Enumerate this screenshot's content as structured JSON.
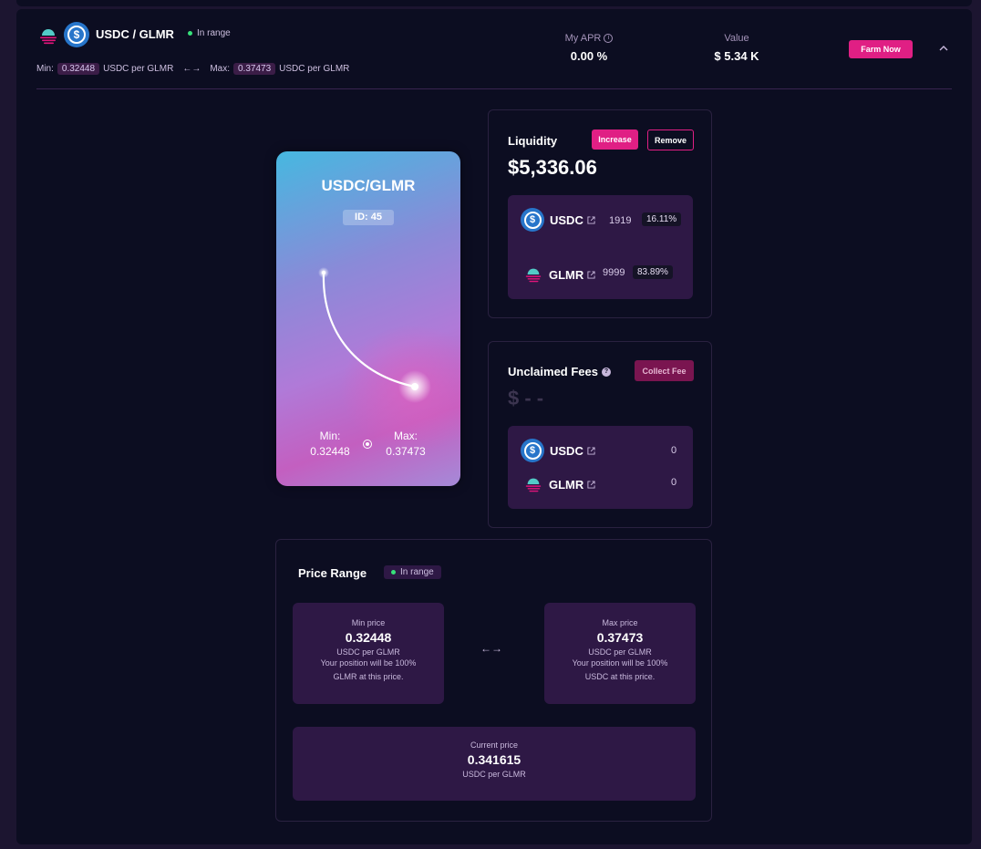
{
  "header": {
    "pair": "USDC / GLMR",
    "status": "In range",
    "min_label": "Min:",
    "min_value": "0.32448",
    "min_unit": "USDC per GLMR",
    "arrows": "←→",
    "max_label": "Max:",
    "max_value": "0.37473",
    "max_unit": "USDC per GLMR",
    "apr_label": "My APR",
    "apr_value": "0.00 %",
    "value_label": "Value",
    "value_value": "$ 5.34 K",
    "farm_button": "Farm Now"
  },
  "nft": {
    "title": "USDC/GLMR",
    "id": "ID: 45",
    "min_label": "Min:",
    "min_value": "0.32448",
    "max_label": "Max:",
    "max_value": "0.37473"
  },
  "liquidity": {
    "title": "Liquidity",
    "increase_button": "Increase",
    "remove_button": "Remove",
    "total": "$5,336.06",
    "tokens": [
      {
        "symbol": "USDC",
        "amount": "1919",
        "share": "16.11%"
      },
      {
        "symbol": "GLMR",
        "amount": "9999",
        "share": "83.89%"
      }
    ]
  },
  "fees": {
    "title": "Unclaimed Fees",
    "collect_button": "Collect Fee",
    "total": "$ - -",
    "tokens": [
      {
        "symbol": "USDC",
        "amount": "0"
      },
      {
        "symbol": "GLMR",
        "amount": "0"
      }
    ]
  },
  "price_range": {
    "title": "Price Range",
    "status": "In range",
    "arrows": "←→",
    "min": {
      "label": "Min price",
      "value": "0.32448",
      "unit": "USDC per GLMR",
      "note": "Your position will be 100% GLMR at this price."
    },
    "max": {
      "label": "Max price",
      "value": "0.37473",
      "unit": "USDC per GLMR",
      "note": "Your position will be 100% USDC at this price."
    },
    "current": {
      "label": "Current price",
      "value": "0.341615",
      "unit": "USDC per GLMR"
    }
  },
  "colors": {
    "accent": "#e01f84",
    "panel": "#0c0d21",
    "card": "#2e1845",
    "status_dot": "#37e07a",
    "usdc": "#2775ca"
  },
  "icons": [
    "glmr-logo-icon",
    "usdc-logo-icon",
    "info-icon",
    "external-link-icon",
    "chevron-up-icon",
    "target-icon"
  ]
}
